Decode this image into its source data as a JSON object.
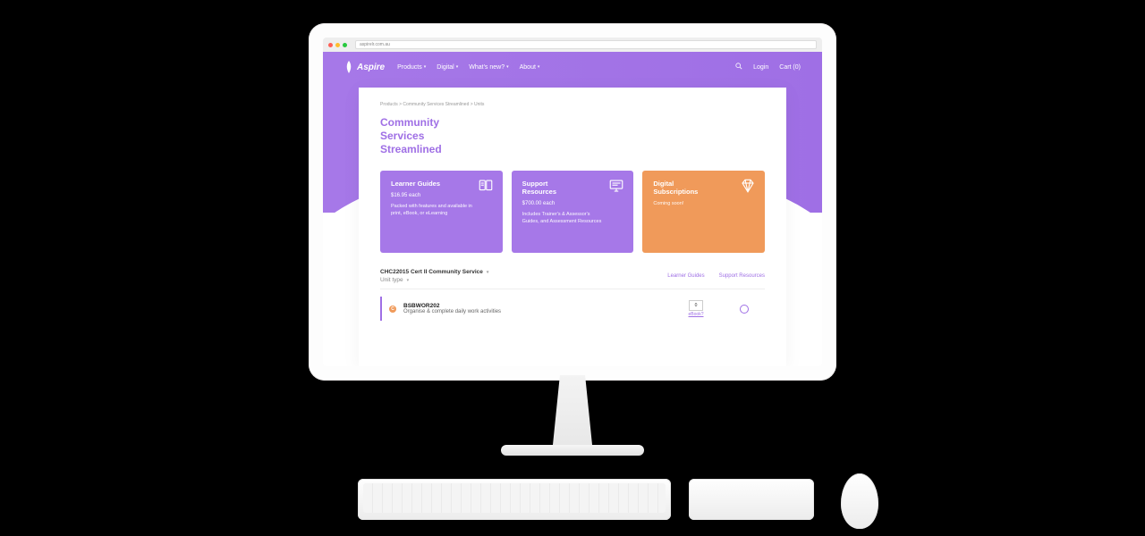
{
  "browser": {
    "url": "aspirelr.com.au"
  },
  "nav": {
    "brand": "Aspire",
    "links": [
      "Products",
      "Digital",
      "What's new?",
      "About"
    ],
    "login": "Login",
    "cart": "Cart (0)",
    "cart_count": 0
  },
  "breadcrumbs": "Products > Community Services Streamlined > Units",
  "page_title_l1": "Community",
  "page_title_l2": "Services",
  "page_title_l3": "Streamlined",
  "cards": [
    {
      "title": "Learner Guides",
      "price": "$16.95 each",
      "body": "Packed with features and available in print, eBook, or eLearning",
      "icon": "book-icon"
    },
    {
      "title": "Support Resources",
      "price": "$700.00 each",
      "body": "Includes Trainer's & Assessor's Guides, and Assessment Resources",
      "icon": "monitor-icon"
    },
    {
      "title": "Digital Subscriptions",
      "price": "",
      "body": "Coming soon!",
      "icon": "diamond-icon"
    }
  ],
  "filter": {
    "course": "CHC22015 Cert II Community Service",
    "unit_type": "Unit type",
    "tabs": [
      "Learner Guides",
      "Support Resources"
    ]
  },
  "unit": {
    "badge": "C",
    "code": "BSBWOR202",
    "desc": "Organise & complete daily work activities",
    "lg_qty": "0",
    "lg_label": "eBook?"
  },
  "colors": {
    "purple": "#9f6fe5",
    "orange": "#f09a5a"
  }
}
